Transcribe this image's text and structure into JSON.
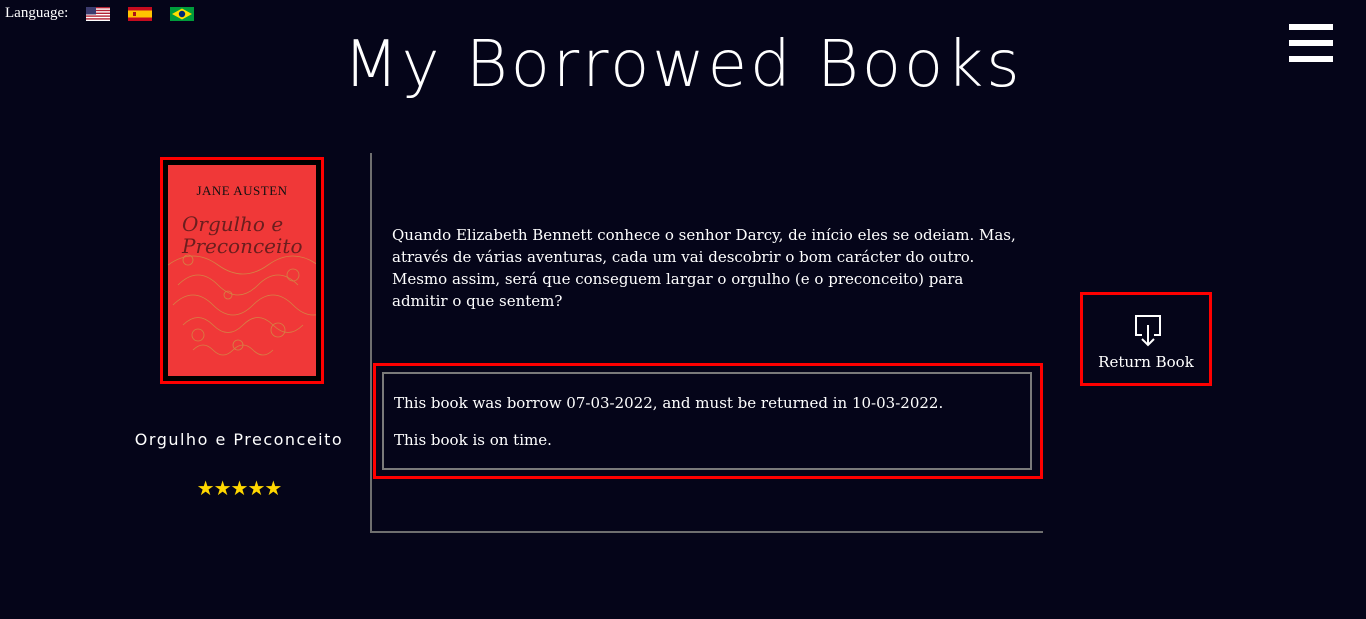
{
  "language_bar": {
    "label": "Language:",
    "flags": [
      {
        "icon": "us-flag-icon",
        "language": "English"
      },
      {
        "icon": "spain-flag-icon",
        "language": "Spanish"
      },
      {
        "icon": "brazil-flag-icon",
        "language": "Portuguese"
      }
    ]
  },
  "header": {
    "title": "My Borrowed Books",
    "menu_icon": "hamburger-menu-icon"
  },
  "book": {
    "cover": {
      "author": "JANE AUSTEN",
      "title": "Orgulho e Preconceito",
      "background_color": "#f03838"
    },
    "name": "Orgulho e Preconceito",
    "rating_stars": "★★★★★",
    "rating_value": 5,
    "description": "Quando Elizabeth Bennett conhece o senhor Darcy, de início eles se odeiam. Mas, através de várias aventuras, cada um vai descobrir o bom carácter do outro. Mesmo assim, será que conseguem largar o orgulho (e o preconceito) para admitir o que sentem?",
    "status": {
      "borrow_line": "This book was borrow 07-03-2022, and must be returned in 10-03-2022.",
      "on_time_line": "This book is on time."
    }
  },
  "actions": {
    "return_label": "Return Book",
    "return_icon": "return-download-icon"
  },
  "colors": {
    "background": "#050519",
    "highlight_border": "#ff0000",
    "star": "#ffd700"
  }
}
